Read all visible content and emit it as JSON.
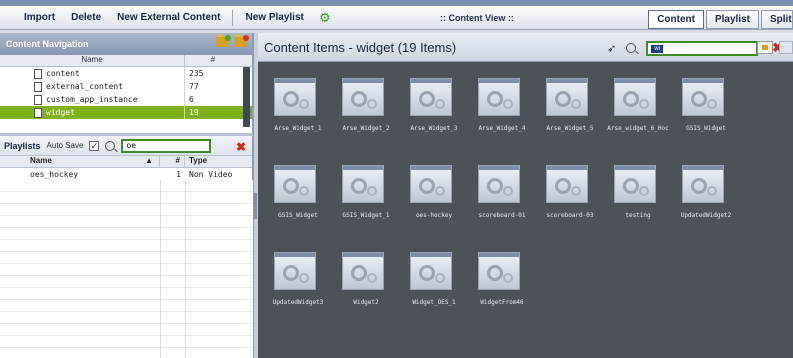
{
  "toolbar": {
    "import": "Import",
    "delete": "Delete",
    "new_external": "New External Content",
    "new_playlist": "New Playlist",
    "view_title": ":: Content View ::",
    "tabs": [
      "Content",
      "Playlist",
      "Split"
    ]
  },
  "nav": {
    "title": "Content Navigation",
    "col_name": "Name",
    "col_count": "#",
    "rows": [
      {
        "name": "content",
        "count": "235"
      },
      {
        "name": "external_content",
        "count": "77"
      },
      {
        "name": "custom_app_instance",
        "count": "6"
      },
      {
        "name": "widget",
        "count": "19"
      }
    ]
  },
  "playlists": {
    "title": "Playlists",
    "auto_save": "Auto Save",
    "search_value": "oe",
    "col_name": "Name",
    "col_hash": "#",
    "col_type": "Type",
    "rows": [
      {
        "name": "oes_hockey",
        "count": "1",
        "type": "Non Video"
      }
    ]
  },
  "content": {
    "title": "Content Items - widget (19 Items)",
    "search_value": "wi",
    "items": [
      "Arse_Widget_1",
      "Arse_Widget_2",
      "Arse_Widget_3",
      "Arse_Widget_4",
      "Arse_Widget_5",
      "Arse_widget_6_Hoc",
      "GSIS_Widget",
      "GSIS_Widget",
      "GSIS_Widget_1",
      "oes-hockey",
      "scoreboard-01",
      "scoreboard-03",
      "testing",
      "UpdatedWidget2",
      "UpdatedWidget3",
      "Widget2",
      "Widget_OES_1",
      "WidgetFrom46"
    ]
  }
}
